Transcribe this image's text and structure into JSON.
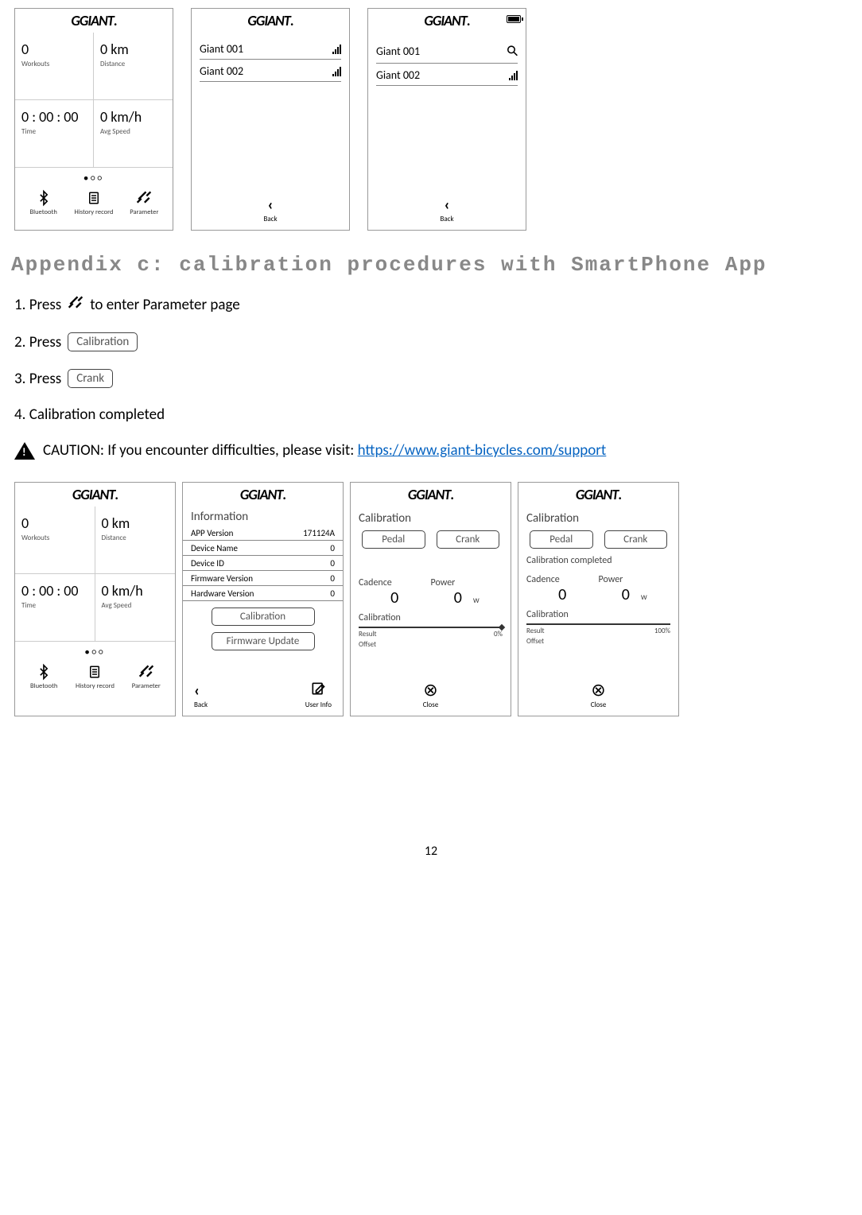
{
  "heading": "Appendix c: calibration procedures with SmartPhone App",
  "steps": {
    "s1a": "1. Press",
    "s1b": "to enter Parameter page",
    "s2": "2. Press",
    "s2_btn": "Calibration",
    "s3": "3. Press",
    "s3_btn": "Crank",
    "s4": "4. Calibration completed"
  },
  "caution": {
    "prefix": "CAUTION: If you encounter difficulties, please visit: ",
    "url": "https://www.giant-bicycles.com/support"
  },
  "logo": "GIANT",
  "screen_home": {
    "workouts_val": "0",
    "workouts_lbl": "Workouts",
    "distance_val": "0 km",
    "distance_lbl": "Distance",
    "time_val": "0 : 00 : 00",
    "time_lbl": "Time",
    "speed_val": "0 km/h",
    "speed_lbl": "Avg Speed",
    "dots": "●○○",
    "bt": "Bluetooth",
    "hist": "History record",
    "param": "Parameter"
  },
  "screen_devices": {
    "d1": "Giant 001",
    "d2": "Giant 002",
    "back": "Back"
  },
  "screen_info": {
    "title": "Information",
    "r1k": "APP Version",
    "r1v": "171124A",
    "r2k": "Device Name",
    "r2v": "0",
    "r3k": "Device ID",
    "r3v": "0",
    "r4k": "Firmware Version",
    "r4v": "0",
    "r5k": "Hardware Version",
    "r5v": "0",
    "btn1": "Calibration",
    "btn2": "Firmware Update",
    "back": "Back",
    "userinfo": "User Info"
  },
  "screen_calib": {
    "title": "Calibration",
    "pedal": "Pedal",
    "crank": "Crank",
    "cadence_lbl": "Cadence",
    "cadence_val": "0",
    "power_lbl": "Power",
    "power_val": "0",
    "power_unit": "w",
    "calib_lbl": "Calibration",
    "result": "Result",
    "offset": "Offset",
    "pct0": "0%",
    "pct100": "100%",
    "close": "Close",
    "completed": "Calibration completed"
  },
  "page_number": "12"
}
